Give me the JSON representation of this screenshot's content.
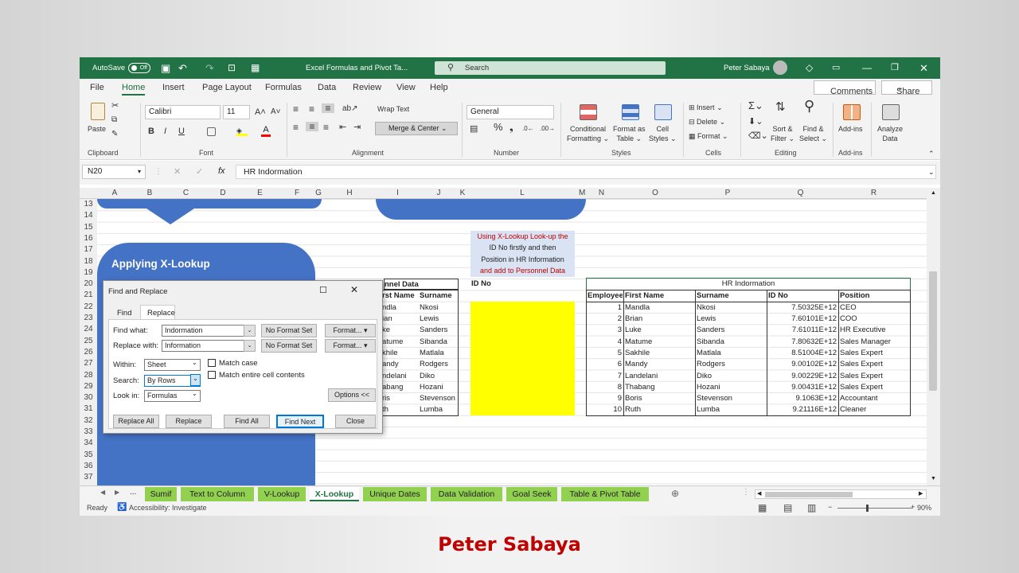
{
  "titlebar": {
    "autosave": "AutoSave",
    "toggle": "Off",
    "filename": "Excel Formulas and Pivot Ta...",
    "search": "Search",
    "user": "Peter Sabaya"
  },
  "menu": [
    "File",
    "Home",
    "Insert",
    "Page Layout",
    "Formulas",
    "Data",
    "Review",
    "View",
    "Help"
  ],
  "comments": "Comments",
  "share": "Share",
  "ribbon": {
    "paste": "Paste",
    "clipboard": "Clipboard",
    "font_name": "Calibri",
    "font_size": "11",
    "font": "Font",
    "wrap": "Wrap Text",
    "merge": "Merge & Center",
    "alignment": "Alignment",
    "numfmt": "General",
    "number": "Number",
    "cond1": "Conditional",
    "cond2": "Formatting",
    "fmt1": "Format as",
    "fmt2": "Table",
    "cell1": "Cell",
    "cell2": "Styles",
    "styles": "Styles",
    "insert": "Insert",
    "delete": "Delete",
    "format": "Format",
    "cells": "Cells",
    "sort1": "Sort &",
    "sort2": "Filter",
    "find1": "Find &",
    "find2": "Select",
    "editing": "Editing",
    "addins": "Add-ins",
    "addins_g": "Add-ins",
    "an1": "Analyze",
    "an2": "Data"
  },
  "formula": {
    "namebox": "N20",
    "value": "HR Indormation"
  },
  "columns": [
    "A",
    "B",
    "C",
    "D",
    "E",
    "F",
    "G",
    "H",
    "I",
    "J",
    "K",
    "L",
    "M",
    "N",
    "O",
    "P",
    "Q",
    "R"
  ],
  "rows": [
    "13",
    "14",
    "15",
    "16",
    "17",
    "18",
    "19",
    "20",
    "21",
    "22",
    "23",
    "24",
    "25",
    "26",
    "27",
    "28",
    "29",
    "30",
    "31",
    "32",
    "33",
    "34",
    "35",
    "36",
    "37"
  ],
  "sheet": {
    "banner": "Applying X-Lookup",
    "note": [
      "Using X-Lookup Look-up the",
      "ID No firstly and then",
      "Position in HR Information",
      "and add to Personnel Data"
    ],
    "personnel_title": "nnel Data",
    "personnel_idno": "ID No",
    "personnel_headers": [
      "rst Name",
      "Surname"
    ],
    "personnel_rows": [
      [
        "ndla",
        "Nkosi"
      ],
      [
        "ian",
        "Lewis"
      ],
      [
        "ke",
        "Sanders"
      ],
      [
        "atume",
        "Sibanda"
      ],
      [
        "khile",
        "Matlala"
      ],
      [
        "andy",
        "Rodgers"
      ],
      [
        "ndelani",
        "Diko"
      ],
      [
        "abang",
        "Hozani"
      ],
      [
        "ris",
        "Stevenson"
      ],
      [
        "th",
        "Lumba"
      ]
    ],
    "hr_title": "HR Indormation",
    "hr_headers": [
      "Employee",
      "First Name",
      "Surname",
      "ID No",
      "Position"
    ],
    "hr_rows": [
      [
        "1",
        "Mandla",
        "Nkosi",
        "7.50325E+12",
        "CEO"
      ],
      [
        "2",
        "Brian",
        "Lewis",
        "7.60101E+12",
        "COO"
      ],
      [
        "3",
        "Luke",
        "Sanders",
        "7.61011E+12",
        "HR Executive"
      ],
      [
        "4",
        "Matume",
        "Sibanda",
        "7.80632E+12",
        "Sales Manager"
      ],
      [
        "5",
        "Sakhile",
        "Matlala",
        "8.51004E+12",
        "Sales Expert"
      ],
      [
        "6",
        "Mandy",
        "Rodgers",
        "9.00102E+12",
        "Sales Expert"
      ],
      [
        "7",
        "Landelani",
        "Diko",
        "9.00229E+12",
        "Sales Expert"
      ],
      [
        "8",
        "Thabang",
        "Hozani",
        "9.00431E+12",
        "Sales Expert"
      ],
      [
        "9",
        "Boris",
        "Stevenson",
        "9.1063E+12",
        "Accountant"
      ],
      [
        "10",
        "Ruth",
        "Lumba",
        "9.21116E+12",
        "Cleaner"
      ]
    ]
  },
  "dialog": {
    "title": "Find and Replace",
    "tab_find": "Find",
    "tab_replace": "Replace",
    "find_label": "Find what:",
    "find_value": "Indormation",
    "replace_label": "Replace with:",
    "replace_value": "Information",
    "no_format": "No Format Set",
    "format": "Format...",
    "within_label": "Within:",
    "within": "Sheet",
    "search_label": "Search:",
    "search": "By Rows",
    "lookin_label": "Look in:",
    "lookin": "Formulas",
    "match_case": "Match case",
    "match_entire": "Match entire cell contents",
    "options": "Options <<",
    "replace_all": "Replace All",
    "replace": "Replace",
    "find_all": "Find All",
    "find_next": "Find Next",
    "close": "Close"
  },
  "tabs": [
    "Sumif",
    "Text to Column",
    "V-Lookup",
    "X-Lookup",
    "Unique Dates",
    "Data Validation",
    "Goal Seek",
    "Table & Pivot Table"
  ],
  "tabs_more": "...",
  "status": {
    "ready": "Ready",
    "accessibility": "Accessibility: Investigate",
    "zoom": "90%"
  },
  "caption": "Peter Sabaya",
  "colors": {
    "excel_green": "#217346",
    "banner_blue": "#4472c4",
    "highlight": "#ffff00",
    "tab_green": "#92d050",
    "caption_red": "#c00000"
  }
}
